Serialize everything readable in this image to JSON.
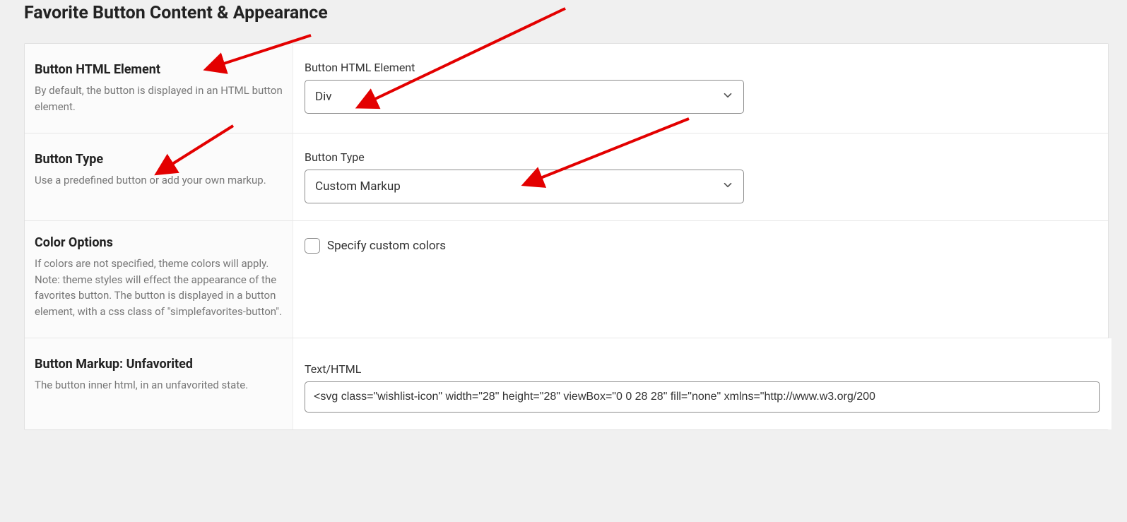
{
  "page": {
    "title": "Favorite Button Content & Appearance"
  },
  "rows": {
    "element": {
      "heading": "Button HTML Element",
      "desc": "By default, the button is displayed in an HTML button element.",
      "field_label": "Button HTML Element",
      "value": "Div"
    },
    "type": {
      "heading": "Button Type",
      "desc": "Use a predefined button or add your own markup.",
      "field_label": "Button Type",
      "value": "Custom Markup"
    },
    "colors": {
      "heading": "Color Options",
      "desc": "If colors are not specified, theme colors will apply. Note: theme styles will effect the appearance of the favorites button. The button is displayed in a button element, with a css class of \"simplefavorites-button\".",
      "checkbox_label": "Specify custom colors",
      "checked": false
    },
    "markup": {
      "heading": "Button Markup: Unfavorited",
      "desc": "The button inner html, in an unfavorited state.",
      "field_label": "Text/HTML",
      "value": "<svg class=\"wishlist-icon\" width=\"28\" height=\"28\" viewBox=\"0 0 28 28\" fill=\"none\" xmlns=\"http://www.w3.org/200"
    }
  },
  "annotation_color": "#e30000"
}
